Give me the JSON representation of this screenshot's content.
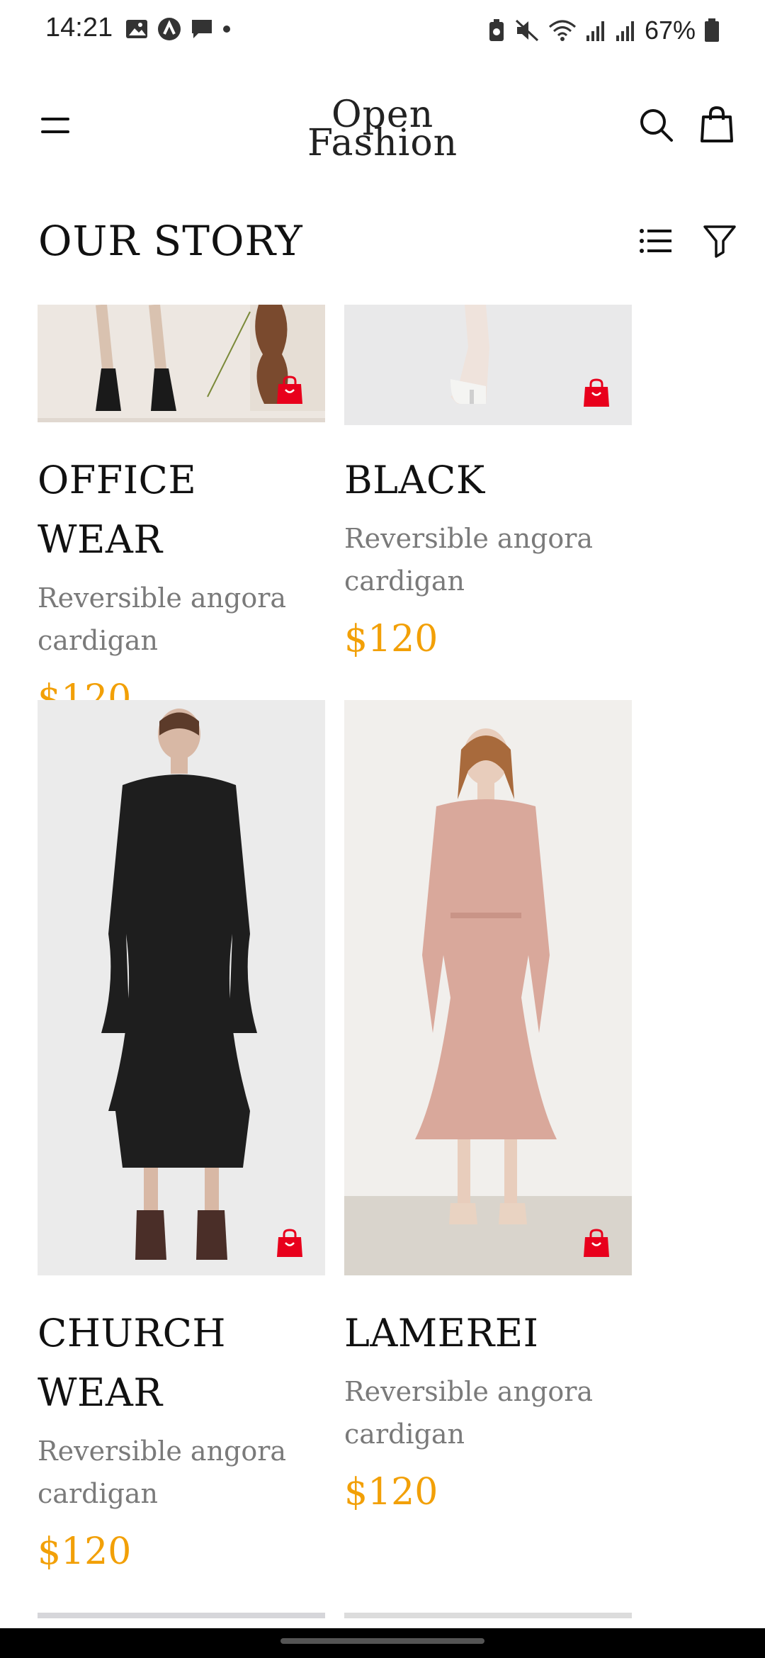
{
  "status_bar": {
    "time": "14:21",
    "battery": "67%"
  },
  "header": {
    "logo_line1": "Open",
    "logo_line2": "Fashion"
  },
  "page": {
    "title": "OUR STORY"
  },
  "products": [
    {
      "name": "OFFICE WEAR",
      "description": "Reversible angora cardigan",
      "price": "$120"
    },
    {
      "name": "BLACK",
      "description": "Reversible angora cardigan",
      "price": "$120"
    },
    {
      "name": "CHURCH WEAR",
      "description": "Reversible angora cardigan",
      "price": "$120"
    },
    {
      "name": "LAMEREI",
      "description": "Reversible angora cardigan",
      "price": "$120"
    }
  ],
  "colors": {
    "accent_price": "#f2a007",
    "bag_icon": "#e8001c"
  },
  "icons": [
    "menu-icon",
    "search-icon",
    "shopping-bag-icon",
    "list-view-icon",
    "filter-icon",
    "add-to-bag-icon"
  ]
}
